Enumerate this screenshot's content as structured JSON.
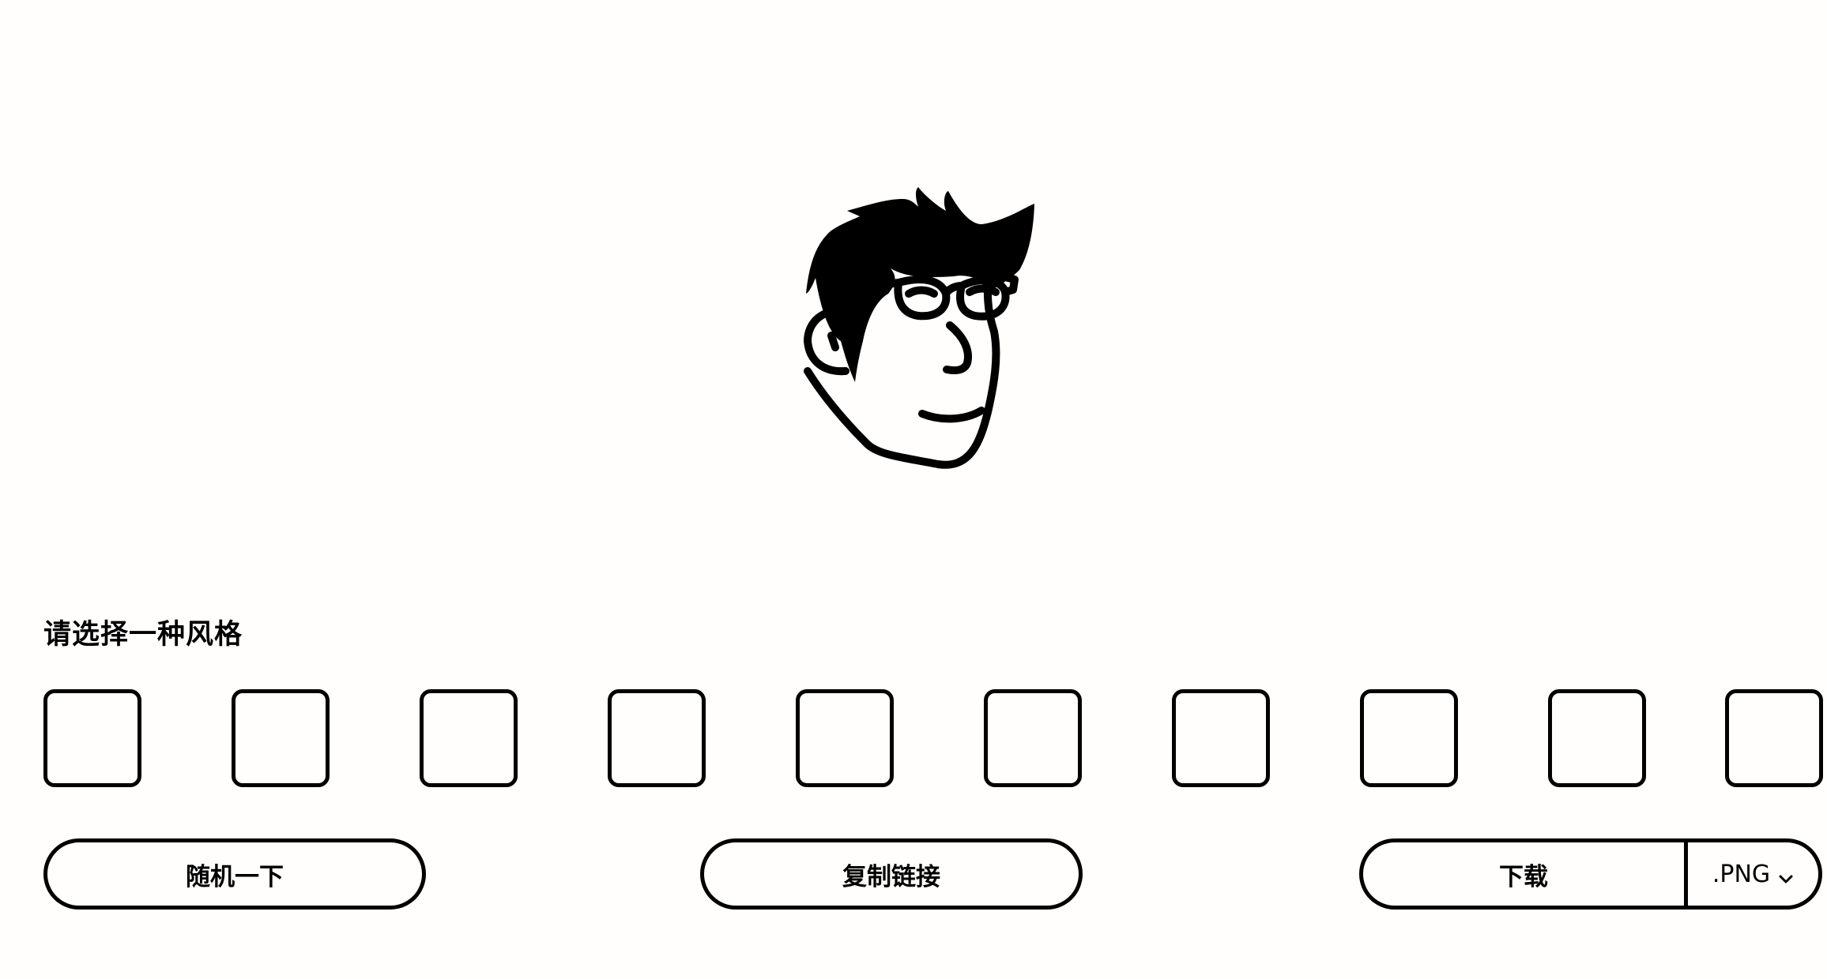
{
  "avatar": {
    "icon": "hand-drawn-face-avatar"
  },
  "style_picker": {
    "title": "请选择一种风格",
    "options_count": 10
  },
  "actions": {
    "random_label": "随机一下",
    "copy_link_label": "复制链接",
    "download_label": "下载",
    "format_selected": ".PNG"
  }
}
